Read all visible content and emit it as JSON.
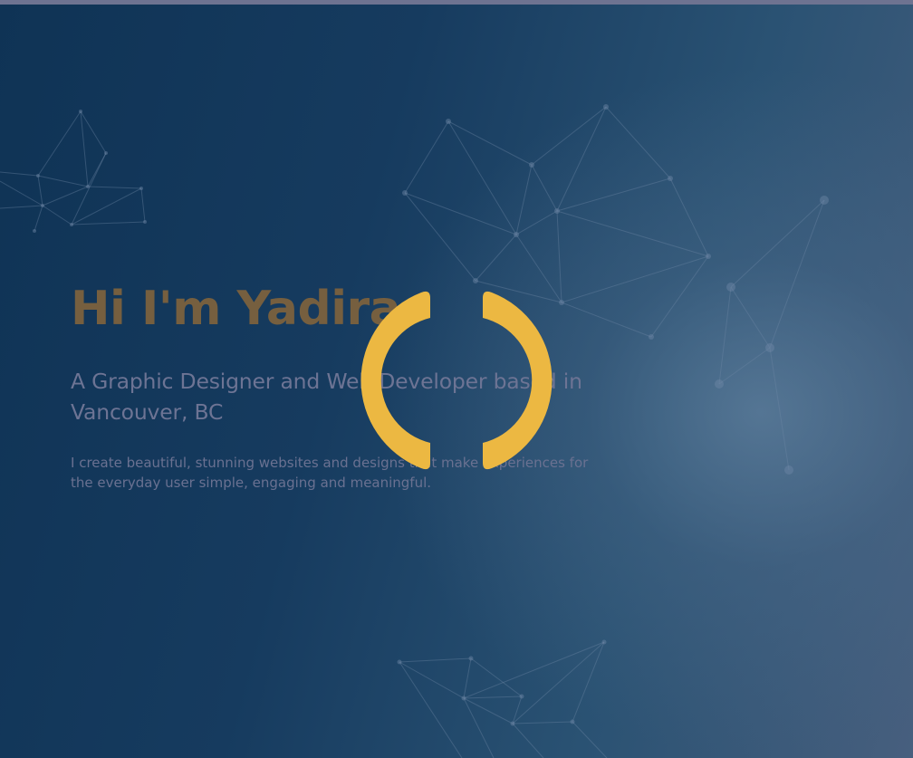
{
  "hero": {
    "title": "Hi I'm Yadira",
    "subtitle": "A Graphic Designer and Web Developer based in Vancouver, BC",
    "description": "I create beautiful, stunning websites and designs that make experiences for the everyday user simple, engaging and meaningful."
  },
  "loader": {
    "icon": "loading-spinner-icon",
    "color": "#ecb842"
  },
  "colors": {
    "background": "#16385a",
    "top_bar": "#6e7391",
    "title": "#765f3f",
    "text": "#6d7494",
    "network_lines": "#6f88a6"
  }
}
